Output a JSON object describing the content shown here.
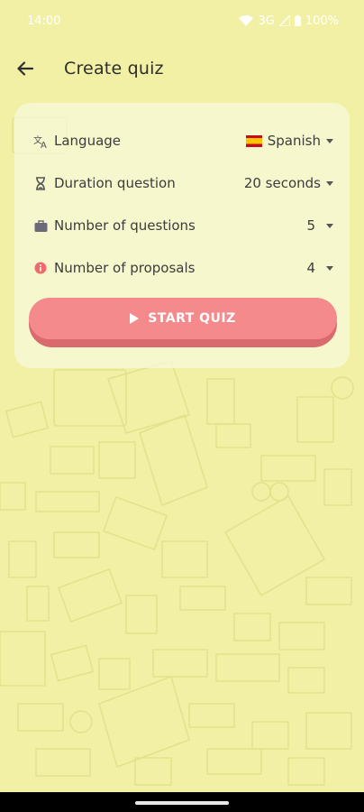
{
  "status_bar": {
    "time": "14:00",
    "network": "3G",
    "battery": "100%"
  },
  "app_bar": {
    "title": "Create quiz"
  },
  "settings": [
    {
      "label": "Language",
      "value": "Spanish",
      "icon": "translate-icon",
      "has_flag": true
    },
    {
      "label": "Duration question",
      "value": "20 seconds",
      "icon": "hourglass-icon"
    },
    {
      "label": "Number of questions",
      "value": "5",
      "icon": "briefcase-icon"
    },
    {
      "label": "Number of proposals",
      "value": "4",
      "icon": "info-icon"
    }
  ],
  "start_button": {
    "label": "START QUIZ"
  },
  "colors": {
    "background": "#f1f0a4",
    "card": "#fafadc",
    "button": "#f58a8c",
    "button_shadow": "#d96a6d",
    "info_icon": "#ef6b6b"
  }
}
